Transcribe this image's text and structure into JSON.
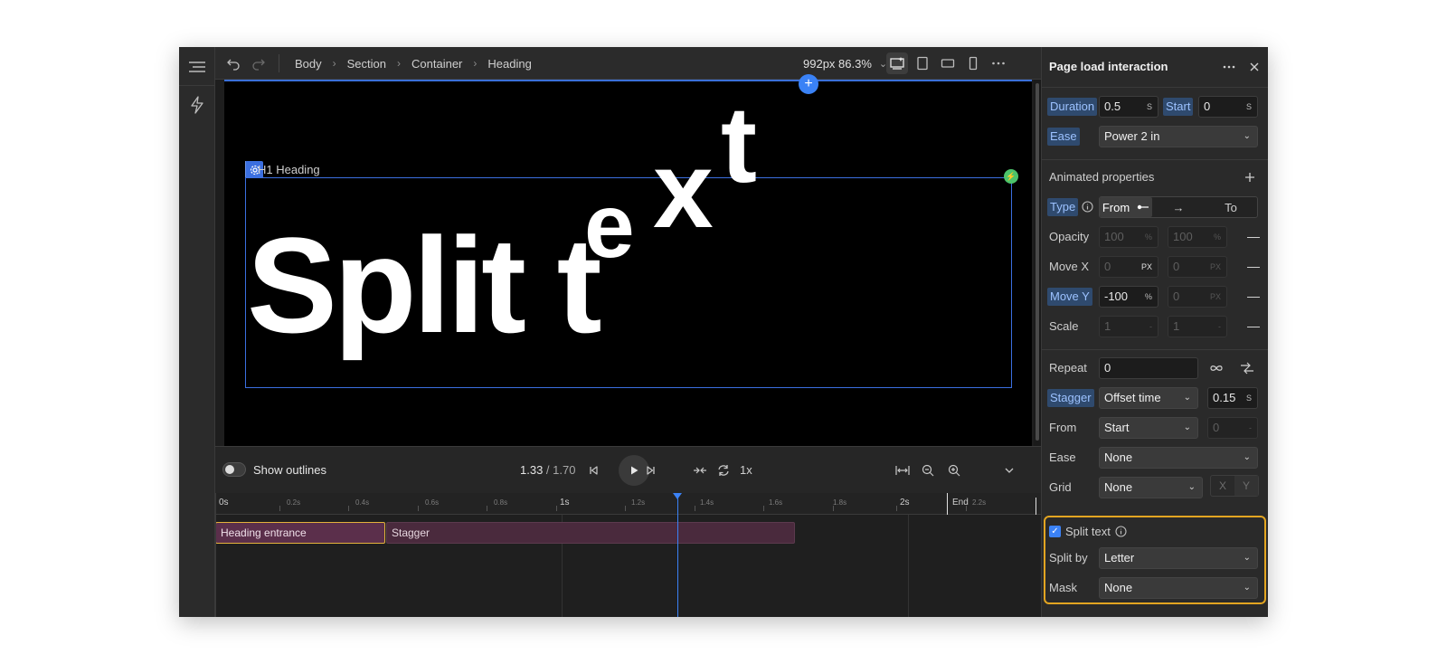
{
  "colors": {
    "accent": "#3b82f6",
    "highlight_border": "#e3a521",
    "track_entrance": "#5b2f4b",
    "track_stagger": "#4a2a3d",
    "canvas_bg": "#000000"
  },
  "topbar": {
    "breadcrumbs": [
      "Body",
      "Section",
      "Container",
      "Heading"
    ],
    "zoom": "992px 86.3%"
  },
  "canvas": {
    "heading_tag": "H1 Heading",
    "heading_letters": [
      "Split t",
      "e",
      "x",
      "t"
    ]
  },
  "timeline": {
    "show_outlines_label": "Show outlines",
    "time_current": "1.33",
    "time_total": " / 1.70",
    "speed": "1x",
    "ticks": [
      "0s",
      "0.2s",
      "0.4s",
      "0.6s",
      "0.8s",
      "1s",
      "1.2s",
      "1.4s",
      "1.6s",
      "1.8s",
      "2s",
      "2.2s"
    ],
    "end_label": "End",
    "tracks": [
      "Heading entrance",
      "Stagger"
    ]
  },
  "panel": {
    "title": "Page load interaction",
    "duration_label": "Duration",
    "duration_value": "0.5",
    "duration_unit": "S",
    "start_label": "Start",
    "start_value": "0",
    "start_unit": "S",
    "ease_label": "Ease",
    "ease_value": "Power 2 in",
    "animated_properties_label": "Animated properties",
    "type_label": "Type",
    "type_options": [
      "From",
      "→",
      "To"
    ],
    "opacity_label": "Opacity",
    "opacity_from": "100",
    "opacity_to": "100",
    "opacity_unit": "%",
    "movex_label": "Move X",
    "movex_from": "0",
    "movex_to": "0",
    "movex_unit": "PX",
    "movey_label": "Move Y",
    "movey_from": "-100",
    "movey_from_unit": "%",
    "movey_to": "0",
    "movey_to_unit": "PX",
    "scale_label": "Scale",
    "scale_from": "1",
    "scale_to": "1",
    "scale_unit": "-",
    "repeat_label": "Repeat",
    "repeat_value": "0",
    "stagger_label": "Stagger",
    "stagger_mode": "Offset time",
    "stagger_value": "0.15",
    "stagger_unit": "S",
    "from_label": "From",
    "from_value": "Start",
    "from_number": "0",
    "from_unit": "-",
    "ease2_label": "Ease",
    "ease2_value": "None",
    "grid_label": "Grid",
    "grid_value": "None",
    "grid_x": "X",
    "grid_y": "Y",
    "split_text_label": "Split text",
    "split_by_label": "Split by",
    "split_by_value": "Letter",
    "mask_label": "Mask",
    "mask_value": "None"
  }
}
